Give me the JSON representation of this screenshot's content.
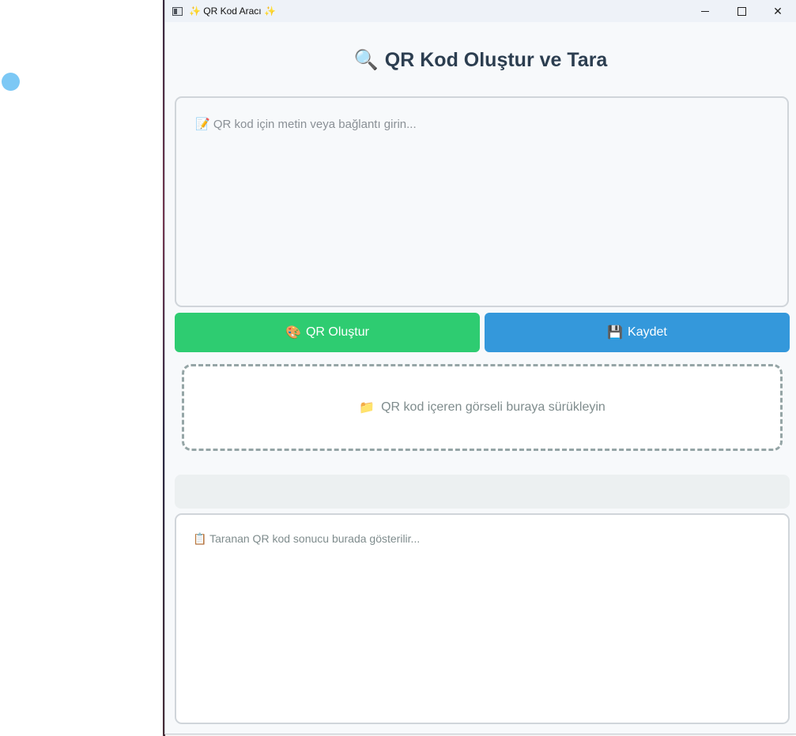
{
  "window": {
    "title": "✨ QR Kod Aracı ✨",
    "controls": {
      "minimize": "",
      "maximize": "",
      "close": "✕"
    }
  },
  "main": {
    "heading_icon": "🔍",
    "heading": "QR Kod Oluştur ve Tara",
    "input_icon": "📝",
    "input_placeholder": "QR kod için metin veya bağlantı girin...",
    "generate_icon": "🎨",
    "generate_label": "QR Oluştur",
    "save_icon": "💾",
    "save_label": "Kaydet",
    "dropzone_icon": "📁",
    "dropzone_label": "QR kod içeren görseli buraya sürükleyin",
    "result_icon": "📋",
    "result_placeholder": "Taranan QR kod sonucu burada gösterilir..."
  },
  "colors": {
    "generate_button": "#2ecc71",
    "save_button": "#3498db",
    "heading_text": "#2c3e50"
  }
}
